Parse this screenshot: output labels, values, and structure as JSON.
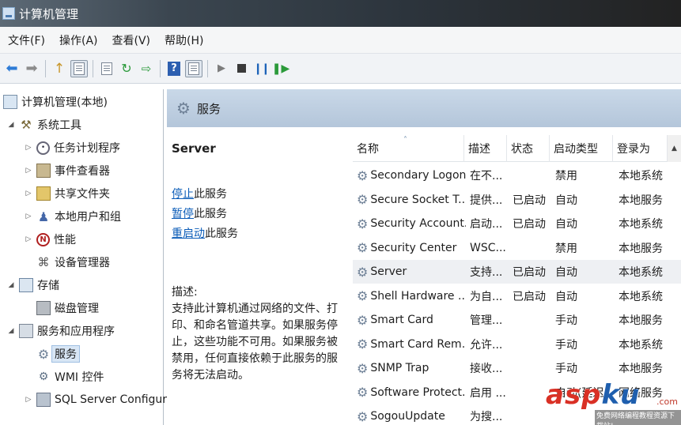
{
  "window": {
    "title": "计算机管理"
  },
  "menu": [
    "文件(F)",
    "操作(A)",
    "查看(V)",
    "帮助(H)"
  ],
  "tree": {
    "root": "计算机管理(本地)",
    "system_tools": "系统工具",
    "task_scheduler": "任务计划程序",
    "event_viewer": "事件查看器",
    "shared_folders": "共享文件夹",
    "local_users": "本地用户和组",
    "performance": "性能",
    "device_manager": "设备管理器",
    "storage": "存储",
    "disk_mgmt": "磁盘管理",
    "services_apps": "服务和应用程序",
    "services": "服务",
    "wmi": "WMI 控件",
    "sql": "SQL Server Configura"
  },
  "pane": {
    "title": "服务",
    "selected_service": "Server",
    "actions": [
      {
        "link": "停止",
        "rest": "此服务"
      },
      {
        "link": "暂停",
        "rest": "此服务"
      },
      {
        "link": "重启动",
        "rest": "此服务"
      }
    ],
    "desc_label": "描述:",
    "description": "支持此计算机通过网络的文件、打印、和命名管道共享。如果服务停止，这些功能不可用。如果服务被禁用，任何直接依赖于此服务的服务将无法启动。"
  },
  "list": {
    "columns": [
      "名称",
      "描述",
      "状态",
      "启动类型",
      "登录为"
    ],
    "rows": [
      [
        "Secondary Logon",
        "在不...",
        "",
        "禁用",
        "本地系统"
      ],
      [
        "Secure Socket T...",
        "提供...",
        "已启动",
        "自动",
        "本地服务"
      ],
      [
        "Security Account...",
        "启动...",
        "已启动",
        "自动",
        "本地系统"
      ],
      [
        "Security Center",
        "WSC...",
        "",
        "禁用",
        "本地服务"
      ],
      [
        "Server",
        "支持...",
        "已启动",
        "自动",
        "本地系统"
      ],
      [
        "Shell Hardware ...",
        "为自...",
        "已启动",
        "自动",
        "本地系统"
      ],
      [
        "Smart Card",
        "管理...",
        "",
        "手动",
        "本地服务"
      ],
      [
        "Smart Card Rem...",
        "允许...",
        "",
        "手动",
        "本地系统"
      ],
      [
        "SNMP Trap",
        "接收...",
        "",
        "手动",
        "本地服务"
      ],
      [
        "Software Protect...",
        "启用 ...",
        "",
        "自动(延迟...",
        "网络服务"
      ],
      [
        "SogouUpdate",
        "为搜...",
        "",
        "",
        ""
      ]
    ],
    "selected_index": 4
  },
  "watermark": {
    "brand_a": "asp",
    "brand_b": "ku",
    "domain": ".com",
    "sub": "免费网络编程教程资源下载站!"
  }
}
